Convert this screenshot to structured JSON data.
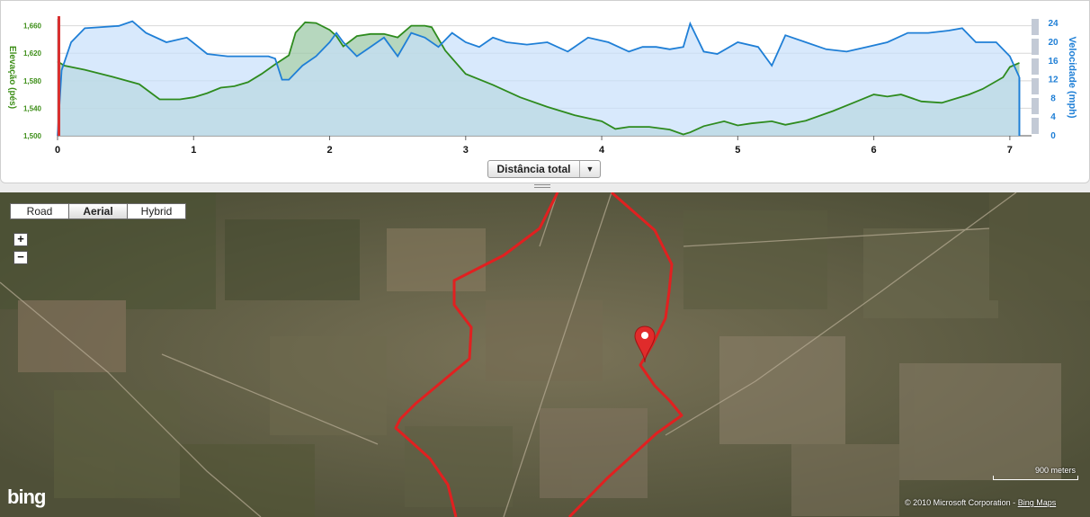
{
  "chart": {
    "y_left_label": "Elevação (pés)",
    "y_right_label": "Velocidade (mph)",
    "y_left_ticks": [
      "1,500",
      "1,540",
      "1,580",
      "1,620",
      "1,660"
    ],
    "y_right_ticks": [
      "0",
      "4",
      "8",
      "12",
      "16",
      "20",
      "24"
    ],
    "x_ticks": [
      "0",
      "1",
      "2",
      "3",
      "4",
      "5",
      "6",
      "7"
    ],
    "x_axis_button": "Distância total",
    "colors": {
      "elevation_line": "#2e8b1e",
      "elevation_fill": "#9ec9a8",
      "speed_line": "#1f7fd6",
      "speed_fill": "#c8e0fb",
      "axis_left": "#3f8f1a",
      "axis_right": "#1f7fd6",
      "cursor": "#d83030"
    }
  },
  "chart_data": {
    "type": "line",
    "xlabel": "Distância total",
    "x_range": [
      0,
      7.1
    ],
    "series": [
      {
        "name": "Elevação (pés)",
        "axis": "left",
        "ylim": [
          1500,
          1670
        ],
        "x": [
          0,
          0.05,
          0.2,
          0.4,
          0.6,
          0.75,
          0.9,
          1.0,
          1.1,
          1.2,
          1.3,
          1.4,
          1.5,
          1.6,
          1.7,
          1.75,
          1.82,
          1.9,
          2.0,
          2.05,
          2.1,
          2.2,
          2.3,
          2.4,
          2.5,
          2.6,
          2.7,
          2.75,
          2.85,
          3.0,
          3.2,
          3.4,
          3.6,
          3.8,
          4.0,
          4.1,
          4.2,
          4.35,
          4.5,
          4.6,
          4.65,
          4.75,
          4.9,
          5.0,
          5.1,
          5.25,
          5.35,
          5.5,
          5.7,
          5.85,
          6.0,
          6.1,
          6.2,
          6.35,
          6.5,
          6.7,
          6.8,
          6.95,
          7.0,
          7.07
        ],
        "values": [
          1608,
          1602,
          1596,
          1586,
          1575,
          1553,
          1553,
          1556,
          1562,
          1570,
          1572,
          1578,
          1590,
          1604,
          1617,
          1650,
          1665,
          1664,
          1654,
          1645,
          1630,
          1645,
          1648,
          1648,
          1643,
          1660,
          1660,
          1658,
          1624,
          1590,
          1574,
          1556,
          1542,
          1530,
          1521,
          1510,
          1513,
          1513,
          1509,
          1502,
          1505,
          1514,
          1521,
          1515,
          1518,
          1521,
          1516,
          1522,
          1536,
          1548,
          1560,
          1557,
          1560,
          1550,
          1548,
          1560,
          1568,
          1585,
          1600,
          1606
        ]
      },
      {
        "name": "Velocidade (mph)",
        "axis": "right",
        "ylim": [
          0,
          25
        ],
        "x": [
          0,
          0.03,
          0.1,
          0.2,
          0.3,
          0.45,
          0.55,
          0.65,
          0.8,
          0.95,
          1.1,
          1.25,
          1.4,
          1.55,
          1.6,
          1.65,
          1.7,
          1.8,
          1.9,
          2.0,
          2.05,
          2.1,
          2.2,
          2.3,
          2.4,
          2.5,
          2.6,
          2.7,
          2.8,
          2.9,
          3.0,
          3.1,
          3.2,
          3.3,
          3.45,
          3.6,
          3.75,
          3.9,
          4.05,
          4.2,
          4.3,
          4.4,
          4.5,
          4.6,
          4.65,
          4.75,
          4.85,
          5.0,
          5.15,
          5.25,
          5.35,
          5.5,
          5.65,
          5.8,
          5.95,
          6.1,
          6.25,
          6.4,
          6.55,
          6.65,
          6.75,
          6.9,
          7.0,
          7.07
        ],
        "values": [
          0,
          14,
          20,
          23,
          23.2,
          23.5,
          24.5,
          22,
          20,
          21,
          17.5,
          17,
          17,
          17,
          16.5,
          12,
          12,
          15,
          17,
          20,
          22,
          20,
          17,
          19,
          21,
          17,
          22,
          21,
          19,
          22,
          20,
          19,
          21,
          20,
          19.5,
          20,
          18,
          21,
          20,
          18,
          19,
          19,
          18.5,
          19,
          24,
          18,
          17.5,
          20,
          19,
          15,
          21.5,
          20,
          18.5,
          18,
          19,
          20,
          22,
          22,
          22.5,
          23,
          20,
          20,
          17,
          12.5
        ]
      }
    ]
  },
  "map": {
    "map_types": [
      "Road",
      "Aerial",
      "Hybrid"
    ],
    "selected_map_type": "Aerial",
    "zoom_in_label": "+",
    "zoom_out_label": "−",
    "logo_text": "bing",
    "scale_label": "900 meters",
    "copyright_text": "© 2010 Microsoft Corporation - ",
    "copyright_link": "Bing Maps"
  }
}
